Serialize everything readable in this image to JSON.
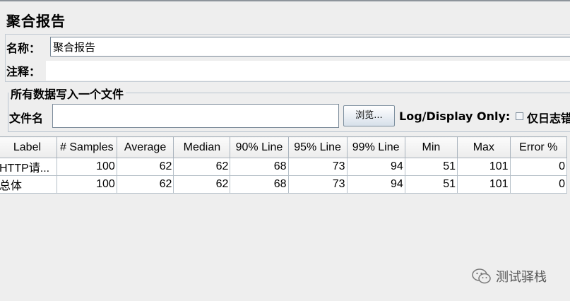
{
  "page": {
    "title": "聚合报告"
  },
  "form": {
    "name_label": "名称：",
    "name_value": "聚合报告",
    "comment_label": "注释：",
    "comment_value": ""
  },
  "file_panel": {
    "group_title": "所有数据写入一个文件",
    "file_label": "文件名",
    "file_value": "",
    "browse_label": "浏览...",
    "log_display_label": "Log/Display Only:",
    "errors_only_label": "仅日志错误",
    "errors_only_checked": false
  },
  "table": {
    "columns": [
      "Label",
      "# Samples",
      "Average",
      "Median",
      "90% Line",
      "95% Line",
      "99% Line",
      "Min",
      "Max",
      "Error %"
    ],
    "rows": [
      [
        "HTTP请...",
        "100",
        "62",
        "62",
        "68",
        "73",
        "94",
        "51",
        "101",
        "0"
      ],
      [
        "总体",
        "100",
        "62",
        "62",
        "68",
        "73",
        "94",
        "51",
        "101",
        "0"
      ]
    ]
  },
  "watermark": {
    "text": "测试驿栈"
  }
}
